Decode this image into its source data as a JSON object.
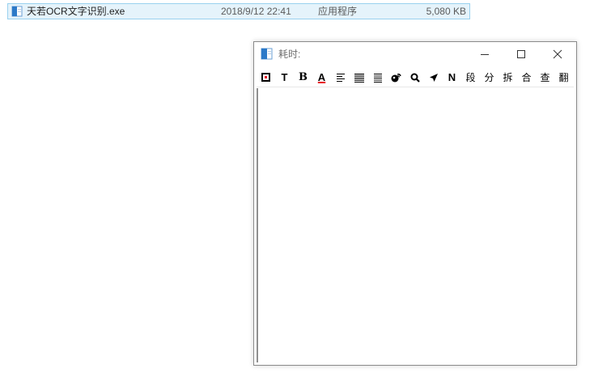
{
  "file_row": {
    "name": "天若OCR文字识别.exe",
    "date": "2018/9/12 22:41",
    "type": "应用程序",
    "size": "5,080 KB"
  },
  "window": {
    "title": "耗时:",
    "toolbar": {
      "text_buttons": {
        "t": "T",
        "b": "B",
        "a": "A",
        "n": "N",
        "paragraph": "段",
        "split": "分",
        "break": "拆",
        "merge": "合",
        "lookup": "查",
        "translate": "翻"
      }
    },
    "content": ""
  },
  "colors": {
    "selection_bg": "#e5f3fb",
    "selection_border": "#99d1ef",
    "font_color_underline": "#e81123",
    "icon_blue": "#2b79c8"
  }
}
